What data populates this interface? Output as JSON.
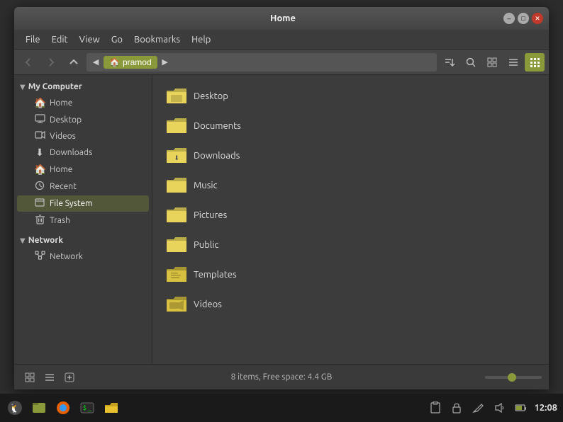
{
  "window": {
    "title": "Home",
    "minimize_label": "–",
    "maximize_label": "□",
    "close_label": "✕"
  },
  "menubar": {
    "items": [
      "File",
      "Edit",
      "View",
      "Go",
      "Bookmarks",
      "Help"
    ]
  },
  "toolbar": {
    "back_disabled": true,
    "forward_disabled": true,
    "up_disabled": false,
    "location_arrow_left": "◀",
    "location_home_label": "pramod",
    "location_arrow_right": "▶",
    "view_icons": [
      "⊞",
      "⊟",
      "▦",
      "▤",
      "▦"
    ]
  },
  "sidebar": {
    "sections": [
      {
        "id": "my-computer",
        "label": "My Computer",
        "expanded": true,
        "items": [
          {
            "id": "home",
            "label": "Home",
            "icon": "🏠"
          },
          {
            "id": "desktop",
            "label": "Desktop",
            "icon": "🖥"
          },
          {
            "id": "videos",
            "label": "Videos",
            "icon": "📹"
          },
          {
            "id": "downloads",
            "label": "Downloads",
            "icon": "⬇"
          },
          {
            "id": "home2",
            "label": "Home",
            "icon": "🏠"
          },
          {
            "id": "recent",
            "label": "Recent",
            "icon": "🕐"
          },
          {
            "id": "filesystem",
            "label": "File System",
            "icon": "💾",
            "active": true
          },
          {
            "id": "trash",
            "label": "Trash",
            "icon": "🗑"
          }
        ]
      },
      {
        "id": "network",
        "label": "Network",
        "expanded": true,
        "items": [
          {
            "id": "network-item",
            "label": "Network",
            "icon": "🖧"
          }
        ]
      }
    ]
  },
  "files": [
    {
      "id": "desktop",
      "name": "Desktop"
    },
    {
      "id": "documents",
      "name": "Documents"
    },
    {
      "id": "downloads",
      "name": "Downloads"
    },
    {
      "id": "music",
      "name": "Music"
    },
    {
      "id": "pictures",
      "name": "Pictures"
    },
    {
      "id": "public",
      "name": "Public"
    },
    {
      "id": "templates",
      "name": "Templates"
    },
    {
      "id": "videos",
      "name": "Videos"
    }
  ],
  "statusbar": {
    "text": "8 items, Free space: 4.4 GB"
  },
  "taskbar": {
    "icons": [
      "🐧",
      "📁",
      "🦊",
      "📺",
      "📂"
    ],
    "sys_icons": [
      "📋",
      "🔒",
      "✏️",
      "🔊",
      "🔋"
    ],
    "time": "12:08"
  }
}
